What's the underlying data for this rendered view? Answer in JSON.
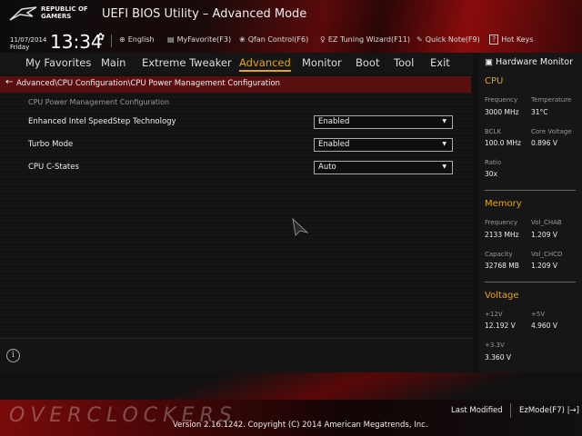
{
  "header": {
    "brand": "REPUBLIC OF GAMERS",
    "title": "UEFI BIOS Utility – Advanced Mode",
    "date": "11/07/2014",
    "day": "Friday",
    "time": "13:34"
  },
  "toolbar": [
    {
      "icon": "globe-icon",
      "label": "English"
    },
    {
      "icon": "favorite-icon",
      "label": "MyFavorite(F3)"
    },
    {
      "icon": "fan-icon",
      "label": "Qfan Control(F6)"
    },
    {
      "icon": "lightbulb-icon",
      "label": "EZ Tuning Wizard(F11)"
    },
    {
      "icon": "note-icon",
      "label": "Quick Note(F9)"
    },
    {
      "icon": "help-icon",
      "label": "Hot Keys"
    }
  ],
  "nav": {
    "tabs": [
      "My Favorites",
      "Main",
      "Extreme Tweaker",
      "Advanced",
      "Monitor",
      "Boot",
      "Tool",
      "Exit"
    ],
    "active": "Advanced"
  },
  "breadcrumb": "Advanced\\CPU Configuration\\CPU Power Management Configuration",
  "main": {
    "subtitle": "CPU Power Management Configuration",
    "settings": [
      {
        "label": "Enhanced Intel SpeedStep Technology",
        "value": "Enabled"
      },
      {
        "label": "Turbo Mode",
        "value": "Enabled"
      },
      {
        "label": "CPU C-States",
        "value": "Auto"
      }
    ]
  },
  "hw": {
    "title": "Hardware Monitor",
    "cpu": {
      "title": "CPU",
      "freq_l": "Frequency",
      "freq": "3000 MHz",
      "temp_l": "Temperature",
      "temp": "31°C",
      "bclk_l": "BCLK",
      "bclk": "100.0 MHz",
      "cv_l": "Core Voltage",
      "cv": "0.896 V",
      "ratio_l": "Ratio",
      "ratio": "30x"
    },
    "mem": {
      "title": "Memory",
      "freq_l": "Frequency",
      "freq": "2133 MHz",
      "vab_l": "Vol_CHAB",
      "vab": "1.209 V",
      "cap_l": "Capacity",
      "cap": "32768 MB",
      "vcd_l": "Vol_CHCD",
      "vcd": "1.209 V"
    },
    "volt": {
      "title": "Voltage",
      "v12_l": "+12V",
      "v12": "12.192 V",
      "v5_l": "+5V",
      "v5": "4.960 V",
      "v33_l": "+3.3V",
      "v33": "3.360 V"
    }
  },
  "footer": {
    "last_modified": "Last Modified",
    "ezmode": "EzMode(F7)",
    "version": "Version 2.16.1242. Copyright (C) 2014 American Megatrends, Inc.",
    "watermark": "OVERCLOCKERS"
  },
  "colors": {
    "accent": "#e3a513",
    "crumb": "#5a0f0f"
  }
}
